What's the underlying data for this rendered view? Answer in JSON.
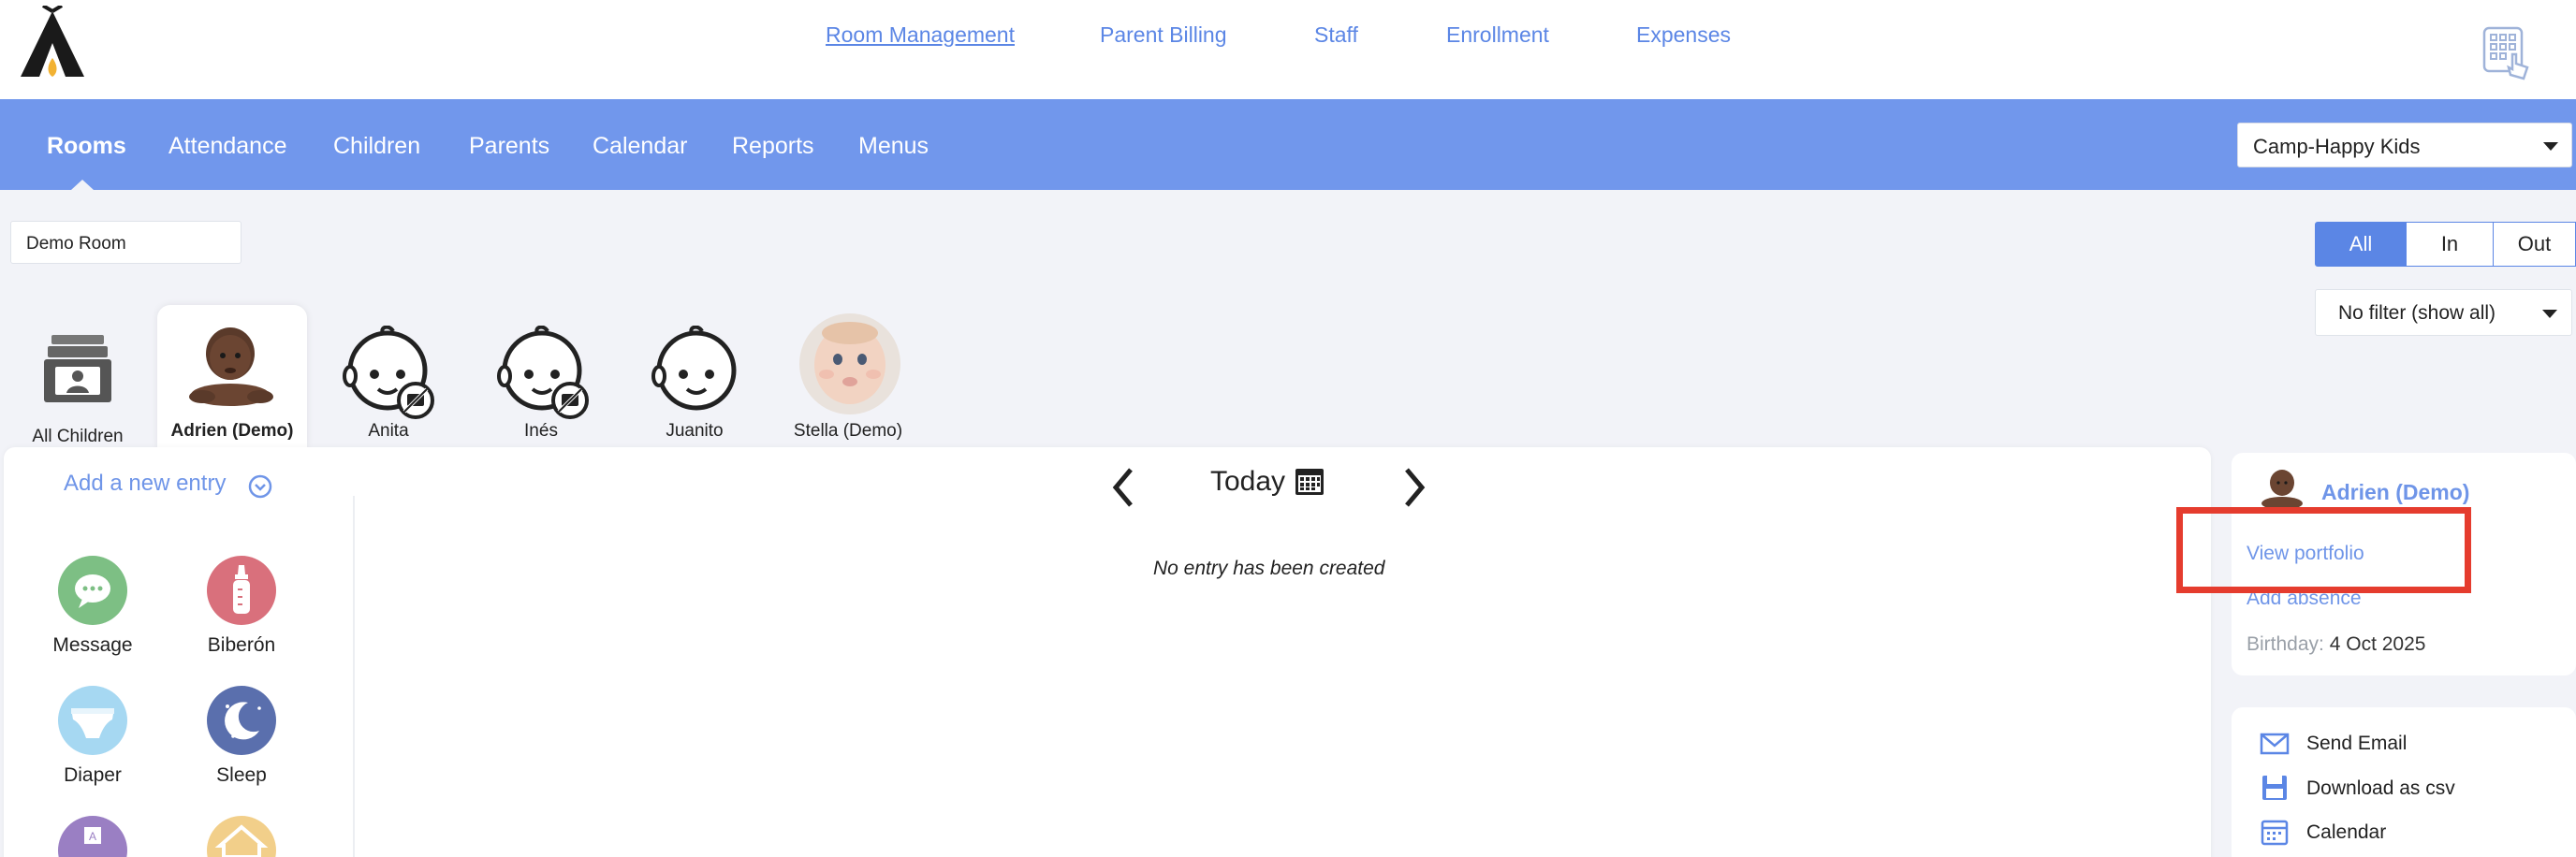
{
  "top_nav": {
    "links": [
      "Room Management",
      "Parent Billing",
      "Staff",
      "Enrollment",
      "Expenses"
    ],
    "active": "Room Management"
  },
  "main_nav": {
    "tabs": [
      "Rooms",
      "Attendance",
      "Children",
      "Parents",
      "Calendar",
      "Reports",
      "Menus"
    ],
    "active": "Rooms",
    "center_select": "Camp-Happy Kids"
  },
  "room_filter": {
    "room_value": "Demo Room",
    "presence_segments": [
      "All",
      "In",
      "Out"
    ],
    "active_segment": "All",
    "filter_select": "No filter (show all)"
  },
  "children": [
    {
      "name": "All Children",
      "avatar": "id-card-stack-icon"
    },
    {
      "name": "Adrien (Demo)",
      "avatar": "baby-photo",
      "selected": true
    },
    {
      "name": "Anita",
      "avatar": "baby-face-icon"
    },
    {
      "name": "Inés",
      "avatar": "baby-face-icon"
    },
    {
      "name": "Juanito",
      "avatar": "baby-face-icon"
    },
    {
      "name": "Stella (Demo)",
      "avatar": "baby-photo"
    }
  ],
  "entry_panel": {
    "add_label": "Add a new entry",
    "entries": [
      {
        "label": "Message",
        "color": "#7dbf84",
        "icon": "chat-bubble-icon"
      },
      {
        "label": "Biberón",
        "color": "#d9707c",
        "icon": "baby-bottle-icon"
      },
      {
        "label": "Diaper",
        "color": "#a6d8f2",
        "icon": "diaper-icon"
      },
      {
        "label": "Sleep",
        "color": "#5a6fad",
        "icon": "moon-stars-icon"
      },
      {
        "label": "",
        "color": "#9a7fc3",
        "icon": "abc-blocks-icon"
      },
      {
        "label": "",
        "color": "#f2cf8a",
        "icon": "house-icon"
      }
    ]
  },
  "date_nav": {
    "label": "Today",
    "empty_message": "No entry has been created"
  },
  "child_card": {
    "name": "Adrien (Demo)",
    "view_portfolio": "View portfolio",
    "add_absence": "Add absence",
    "birthday_key": "Birthday:",
    "birthday_value": "4 Oct 2025"
  },
  "actions": [
    "Send Email",
    "Download as csv",
    "Calendar"
  ],
  "colors": {
    "brand_blue": "#7197ec",
    "link_blue": "#5b86e5",
    "highlight_red": "#e53c2e"
  }
}
